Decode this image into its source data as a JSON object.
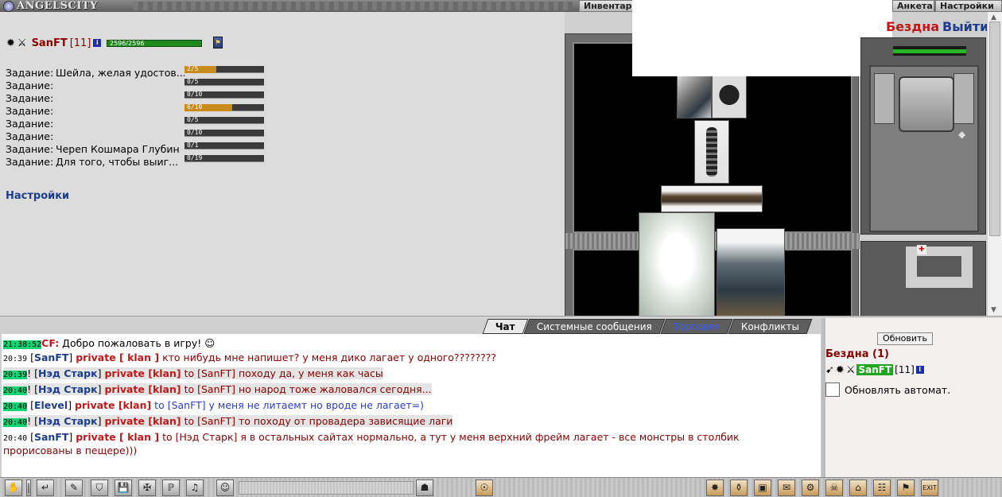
{
  "app": {
    "logo_text": "ANGELSCITY"
  },
  "topnav": {
    "inventory": "Инвентары",
    "anketa": "Анкета",
    "settings": "Настройки"
  },
  "player": {
    "name": "SanFT",
    "level": "[11]",
    "hp": "2596/2596",
    "info_icon": "i"
  },
  "tasks": [
    {
      "label": "Задание:",
      "text": "Шейла, желая удостов...",
      "progress": "2/5",
      "fraction": 0.4
    },
    {
      "label": "Задание:",
      "text": "",
      "progress": "0/5",
      "fraction": 0
    },
    {
      "label": "Задание:",
      "text": "",
      "progress": "0/10",
      "fraction": 0
    },
    {
      "label": "Задание:",
      "text": "",
      "progress": "6/10",
      "fraction": 0.6
    },
    {
      "label": "Задание:",
      "text": "",
      "progress": "0/5",
      "fraction": 0
    },
    {
      "label": "Задание:",
      "text": "",
      "progress": "0/10",
      "fraction": 0
    },
    {
      "label": "Задание:",
      "text": "Череп Кошмара Глубин",
      "progress": "0/1",
      "fraction": 0
    },
    {
      "label": "Задание:",
      "text": "Для того, чтобы выиг...",
      "progress": "0/19",
      "fraction": 0
    }
  ],
  "left": {
    "settings_link": "Настройки"
  },
  "location": {
    "name": "Бездна",
    "exit": "Выйти"
  },
  "chat_tabs": [
    "Чат",
    "Системные сообщения",
    "Торговля",
    "Конфликты"
  ],
  "chat": [
    {
      "ts": "21:38:52",
      "hl": true,
      "parts": [
        [
          "priv",
          "CF:"
        ],
        [
          "plain",
          " Добро пожаловать в игру! ☺"
        ]
      ]
    },
    {
      "ts": "20:39",
      "hl": false,
      "gray": false,
      "parts": [
        [
          "plain",
          " ["
        ],
        [
          "nick",
          "SanFT"
        ],
        [
          "plain",
          "] "
        ],
        [
          "priv",
          "private [ klan ]"
        ],
        [
          "msg",
          " кто нибудь мне напишет? у меня дико лагает у одного????????"
        ]
      ]
    },
    {
      "ts": "20:39",
      "hl": true,
      "gray": true,
      "parts": [
        [
          "plain",
          "! ["
        ],
        [
          "nick",
          "Нэд Старк"
        ],
        [
          "plain",
          "] "
        ],
        [
          "priv",
          "private [klan]"
        ],
        [
          "to",
          " to [SanFT]"
        ],
        [
          "msg",
          " походу да, у меня как часы"
        ]
      ]
    },
    {
      "ts": "20:40",
      "hl": true,
      "gray": true,
      "parts": [
        [
          "plain",
          "! ["
        ],
        [
          "nick",
          "Нэд Старк"
        ],
        [
          "plain",
          "] "
        ],
        [
          "priv",
          "private [klan]"
        ],
        [
          "to",
          " to [SanFT]"
        ],
        [
          "msg",
          " но народ тоже жаловался сегодня..."
        ]
      ]
    },
    {
      "ts": "20:40",
      "hl": true,
      "gray": false,
      "parts": [
        [
          "plain",
          " ["
        ],
        [
          "nick",
          "Elevel"
        ],
        [
          "plain",
          "] "
        ],
        [
          "priv",
          "private [klan]"
        ],
        [
          "msgb",
          " to [SanFT] у меня не литаемт но вроде не лагает=)"
        ]
      ]
    },
    {
      "ts": "20:40",
      "hl": true,
      "gray": true,
      "parts": [
        [
          "plain",
          "! ["
        ],
        [
          "nick",
          "Нэд Старк"
        ],
        [
          "plain",
          "] "
        ],
        [
          "priv",
          "private [klan]"
        ],
        [
          "to",
          " to [SanFT]"
        ],
        [
          "msg",
          " то походу от провадера зависящие лаги"
        ]
      ]
    },
    {
      "ts": "20:40",
      "hl": false,
      "gray": false,
      "parts": [
        [
          "plain",
          " ["
        ],
        [
          "nick",
          "SanFT"
        ],
        [
          "plain",
          "] "
        ],
        [
          "priv",
          "private [ klan ]"
        ],
        [
          "to",
          " to [Нэд Старк]"
        ],
        [
          "msg",
          " я в остальных сайтах нормально, а тут у меня верхний фрейм лагает - все монстры в столбик"
        ]
      ]
    }
  ],
  "chat_wrap": "прорисованы в пещере)))",
  "rightpanel": {
    "refresh": "Обновить",
    "room_title": "Бездна (1)",
    "user_name": "SanFT",
    "user_level": "[11]",
    "auto_refresh": "Обновлять автомат."
  },
  "toolbar": {
    "left_icons": [
      "hand-icon",
      "separator-icon",
      "enter-icon",
      "eraser-icon",
      "filter-icon",
      "save-icon",
      "walk-icon",
      "pl-icon",
      "sound-icon",
      "smile-icon"
    ],
    "right_icons": [
      "flame-icon",
      "bag-icon",
      "chest-icon",
      "scroll-icon",
      "gear-icon",
      "skull-icon",
      "house-icon",
      "group-icon",
      "flag-icon",
      "exit-icon"
    ],
    "exit_label": "EXIT"
  },
  "colors": {
    "nick": "#1c3d8c",
    "private": "#c01818",
    "message": "#8b0000",
    "ts_highlight": "#14d474",
    "hp": "#1e8a1e",
    "task_fill": "#c98a1a"
  }
}
